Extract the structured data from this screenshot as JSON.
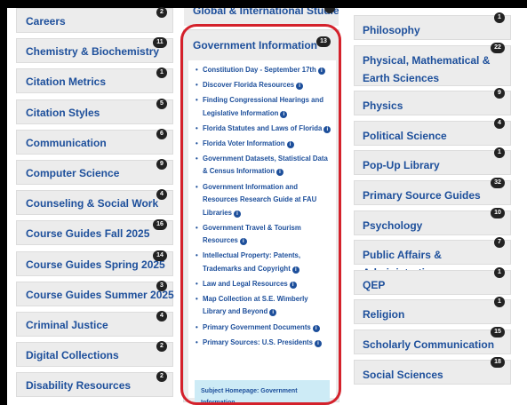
{
  "left_categories": [
    {
      "label": "Careers",
      "count": "2"
    },
    {
      "label": "Chemistry & Biochemistry",
      "count": "11"
    },
    {
      "label": "Citation Metrics",
      "count": "1"
    },
    {
      "label": "Citation Styles",
      "count": "5"
    },
    {
      "label": "Communication",
      "count": "6"
    },
    {
      "label": "Computer Science",
      "count": "9"
    },
    {
      "label": "Counseling & Social Work",
      "count": "4"
    },
    {
      "label": "Course Guides Fall 2025",
      "count": "16"
    },
    {
      "label": "Course Guides Spring 2025",
      "count": "14"
    },
    {
      "label": "Course Guides Summer 2025",
      "count": "3"
    },
    {
      "label": "Criminal Justice",
      "count": "4"
    },
    {
      "label": "Digital Collections",
      "count": "2"
    },
    {
      "label": "Disability Resources",
      "count": "2"
    }
  ],
  "middle": {
    "partial_label": "Global & International Studies",
    "panel": {
      "title": "Government Information",
      "count": "13",
      "items": [
        {
          "label": "Constitution Day - September 17th"
        },
        {
          "label": "Discover Florida Resources"
        },
        {
          "label": "Finding Congressional Hearings and Legislative Information"
        },
        {
          "label": "Florida Statutes and Laws of Florida"
        },
        {
          "label": "Florida Voter Information"
        },
        {
          "label": "Government Datasets, Statistical Data & Census Information"
        },
        {
          "label": "Government Information and Resources Research Guide at FAU Libraries"
        },
        {
          "label": "Government Travel & Tourism Resources"
        },
        {
          "label": "Intellectual Property: Patents, Trademarks and Copyright"
        },
        {
          "label": "Law and Legal Resources"
        },
        {
          "label": "Map Collection at S.E. Wimberly Library and Beyond"
        },
        {
          "label": "Primary Government Documents"
        },
        {
          "label": "Primary Sources: U.S. Presidents"
        }
      ],
      "subject_homepage": "Subject Homepage: Government Information",
      "info_icon": "info-circle-icon"
    },
    "highlight_color": "#d4212b"
  },
  "right_categories": [
    {
      "label": "Philosophy",
      "count": "1"
    },
    {
      "label": "Physical, Mathematical & Earth Sciences",
      "count": "22"
    },
    {
      "label": "Physics",
      "count": "9"
    },
    {
      "label": "Political Science",
      "count": "4"
    },
    {
      "label": "Pop-Up Library",
      "count": "1"
    },
    {
      "label": "Primary Source Guides",
      "count": "32"
    },
    {
      "label": "Psychology",
      "count": "10"
    },
    {
      "label": "Public Affairs & Administration",
      "count": "7"
    },
    {
      "label": "QEP",
      "count": "1"
    },
    {
      "label": "Religion",
      "count": "1"
    },
    {
      "label": "Scholarly Communication",
      "count": "15"
    },
    {
      "label": "Social Sciences",
      "count": "18"
    }
  ],
  "colors": {
    "link": "#1d4f9b",
    "tile": "#ececec",
    "badge": "#222222",
    "subject_bg": "#cdebf6"
  }
}
